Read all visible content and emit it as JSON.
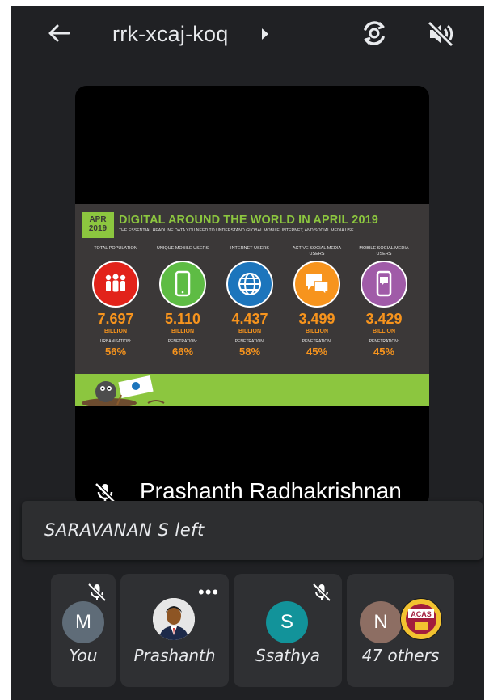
{
  "header": {
    "meeting_code": "rrk-xcaj-koq",
    "icons": [
      "back-arrow-icon",
      "caret-right-icon",
      "switch-camera-icon",
      "speaker-off-icon"
    ]
  },
  "main_tile": {
    "speaker_name": "Prashanth Radhakrishnan",
    "mic": "muted",
    "slide": {
      "badge": "APR 2019",
      "title": "DIGITAL AROUND THE WORLD IN APRIL 2019",
      "subtitle": "THE ESSENTIAL HEADLINE DATA YOU NEED TO UNDERSTAND GLOBAL MOBILE, INTERNET, AND SOCIAL MEDIA USE",
      "stats": [
        {
          "label": "TOTAL POPULATION",
          "value": "7.697",
          "unit": "BILLION",
          "sublabel": "URBANISATION:",
          "percent": "56%",
          "color": "#e2231a"
        },
        {
          "label": "UNIQUE MOBILE USERS",
          "value": "5.110",
          "unit": "BILLION",
          "sublabel": "PENETRATION:",
          "percent": "66%",
          "color": "#5ebc44"
        },
        {
          "label": "INTERNET USERS",
          "value": "4.437",
          "unit": "BILLION",
          "sublabel": "PENETRATION:",
          "percent": "58%",
          "color": "#1c75bc"
        },
        {
          "label": "ACTIVE SOCIAL MEDIA USERS",
          "value": "3.499",
          "unit": "BILLION",
          "sublabel": "PENETRATION:",
          "percent": "45%",
          "color": "#f7941d"
        },
        {
          "label": "MOBILE SOCIAL MEDIA USERS",
          "value": "3.429",
          "unit": "BILLION",
          "sublabel": "PENETRATION:",
          "percent": "45%",
          "color": "#a05ba8"
        }
      ],
      "colors": {
        "accent": "#8cc63f",
        "value": "#f7941d",
        "background": "#3b3838"
      }
    }
  },
  "toast": {
    "text": "SARAVANAN S left"
  },
  "participants": [
    {
      "name": "You",
      "initial": "M",
      "avatar_color": "#5f6c78",
      "mic": "muted"
    },
    {
      "name": "Prashanth",
      "initial": "",
      "avatar_color": "#ffffff",
      "menu": "more-options"
    },
    {
      "name": "Ssathya",
      "initial": "S",
      "avatar_color": "#12939a",
      "mic": "muted"
    },
    {
      "name": "47 others",
      "initial": "N",
      "avatar_color": "#8d6e63",
      "badge_text": "ACAS"
    }
  ]
}
